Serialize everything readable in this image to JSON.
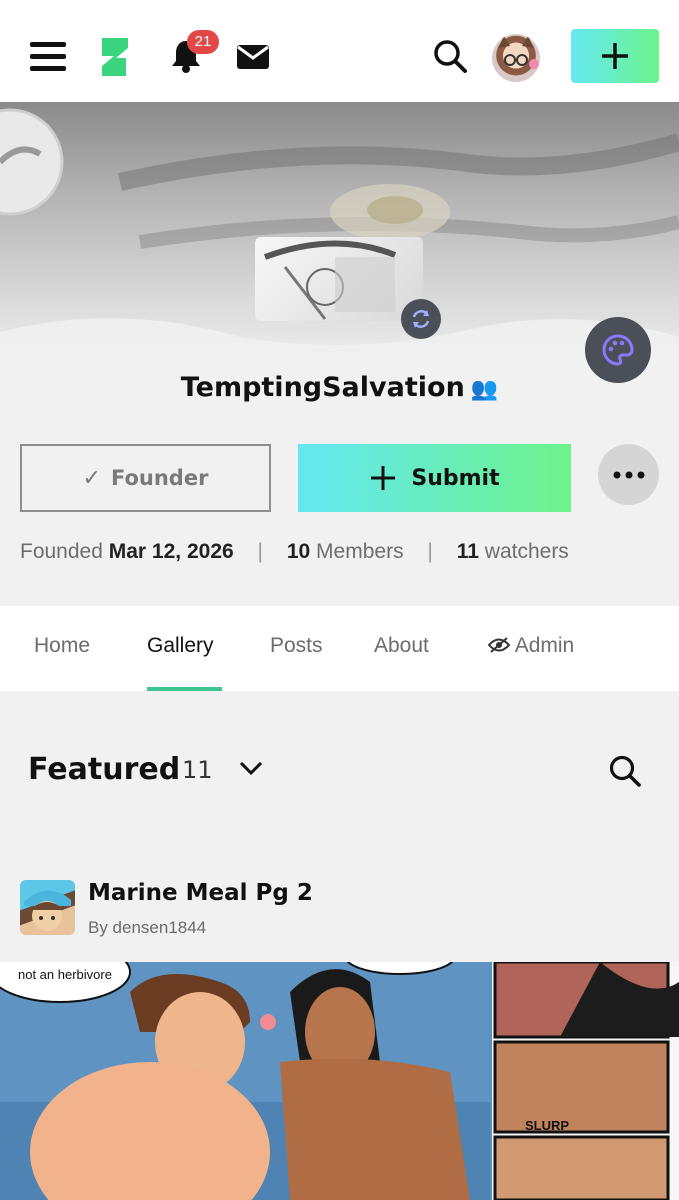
{
  "topbar": {
    "notifications_count": "21",
    "icons": [
      "menu-icon",
      "deviantart-logo-icon",
      "bell-icon",
      "mail-icon",
      "search-icon",
      "avatar",
      "plus-icon"
    ]
  },
  "group": {
    "name": "TemptingSalvation",
    "name_icon": "👥",
    "founder_label": "Founder",
    "founder_check": "✓",
    "submit_label": "Submit"
  },
  "stats": {
    "founded_label": "Founded",
    "founded_date": "Mar 12, 2026",
    "members_count": "10",
    "members_label": "Members",
    "watchers_count": "11",
    "watchers_label": "watchers"
  },
  "tabs": [
    {
      "label": "Home"
    },
    {
      "label": "Gallery",
      "active": true
    },
    {
      "label": "Posts"
    },
    {
      "label": "About"
    },
    {
      "label": "Admin"
    }
  ],
  "featured": {
    "title": "Featured",
    "count": "11"
  },
  "deviation": {
    "title": "Marine Meal Pg 2",
    "author": "By densen1844",
    "speech_bubble": "not an herbivore",
    "sfx": "SLURP"
  },
  "colors": {
    "accent_gradient_start": "#66e9f2",
    "accent_gradient_end": "#6cf28c",
    "tab_underline": "#3fc48d",
    "badge": "#e34848"
  }
}
